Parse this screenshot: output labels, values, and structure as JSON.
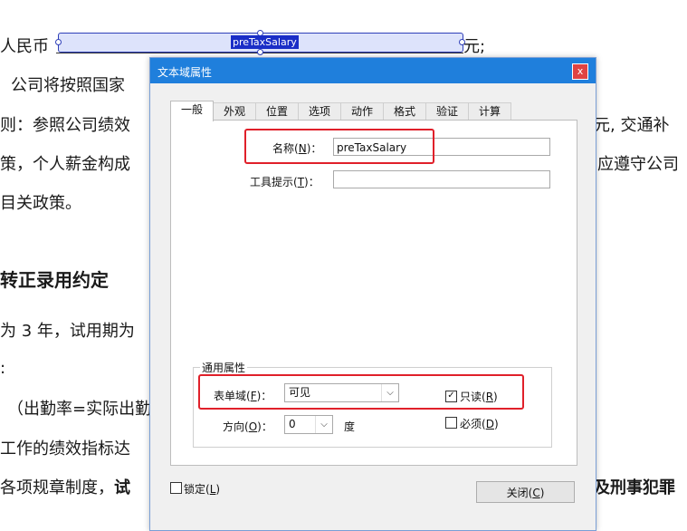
{
  "document": {
    "line1_prefix": "人民币",
    "line1_suffix": "元;",
    "line2": "公司将按照国家",
    "line3_left": "则：参照公司绩效",
    "line3_right": "元, 交通补",
    "line4_left": "策，个人薪金构成",
    "line4_right": "应遵守公司",
    "line5": "目关政策。",
    "heading": "转正录用约定",
    "line6": "为 3 年，试用期为",
    "line7": ":",
    "line8": "（出勤率=实际出勤",
    "line9": "工作的绩效指标达",
    "line10_normal": "各项规章制度，",
    "line10_bold": "试",
    "line10_right": "及刑事犯罪",
    "field_value": "preTaxSalary"
  },
  "dialog": {
    "title": "文本域属性",
    "close_glyph": "x",
    "tabs": [
      "一般",
      "外观",
      "位置",
      "选项",
      "动作",
      "格式",
      "验证",
      "计算"
    ],
    "active_tab": 0,
    "name_label": "名称",
    "name_key": "N",
    "name_value": "preTaxSalary",
    "tooltip_label": "工具提示",
    "tooltip_key": "T",
    "tooltip_value": "",
    "group_title": "通用属性",
    "form_field_label": "表单域",
    "form_field_key": "F",
    "form_field_value": "可见",
    "orientation_label": "方向",
    "orientation_key": "O",
    "orientation_value": "0",
    "degree_label": "度",
    "readonly_label": "只读",
    "readonly_key": "R",
    "readonly_checked": true,
    "required_label": "必须",
    "required_key": "D",
    "required_checked": false,
    "locked_label": "锁定",
    "locked_key": "L",
    "locked_checked": false,
    "close_button_label": "关闭",
    "close_button_key": "C"
  },
  "colors": {
    "title_bar": "#1f7fdc",
    "highlight": "#e0202a",
    "selection": "#1a2ec7"
  }
}
